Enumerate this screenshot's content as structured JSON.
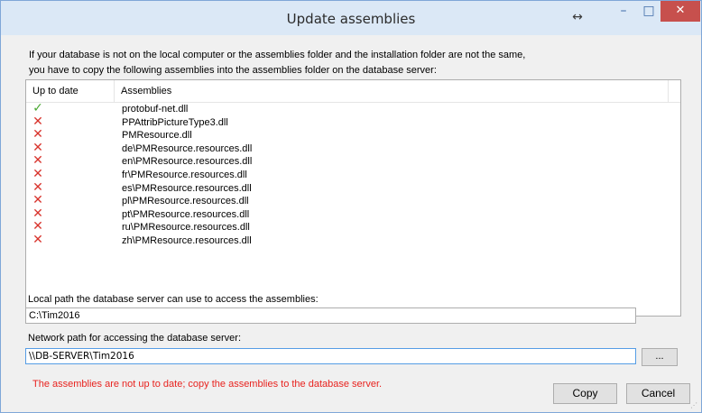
{
  "window": {
    "title": "Update assemblies",
    "resize_glyph": "↔",
    "minimize_glyph": "–",
    "maximize_glyph": "□",
    "close_glyph": "✕"
  },
  "intro": {
    "line1": "If your database is not on the local computer or the assemblies folder and the installation folder are not the same,",
    "line2": "you have to copy the following assemblies into the assemblies folder on the database server:"
  },
  "list": {
    "columns": [
      "Up to date",
      "Assemblies"
    ],
    "rows": [
      {
        "status": "ok",
        "name": "protobuf-net.dll"
      },
      {
        "status": "bad",
        "name": "PPAttribPictureType3.dll"
      },
      {
        "status": "bad",
        "name": "PMResource.dll"
      },
      {
        "status": "bad",
        "name": "de\\PMResource.resources.dll"
      },
      {
        "status": "bad",
        "name": "en\\PMResource.resources.dll"
      },
      {
        "status": "bad",
        "name": "fr\\PMResource.resources.dll"
      },
      {
        "status": "bad",
        "name": "es\\PMResource.resources.dll"
      },
      {
        "status": "bad",
        "name": "pl\\PMResource.resources.dll"
      },
      {
        "status": "bad",
        "name": "pt\\PMResource.resources.dll"
      },
      {
        "status": "bad",
        "name": "ru\\PMResource.resources.dll"
      },
      {
        "status": "bad",
        "name": "zh\\PMResource.resources.dll"
      }
    ],
    "icons": {
      "ok": "✓",
      "bad": "✕"
    },
    "icon_colors": {
      "ok": "#4aa833",
      "bad": "#d8332c"
    }
  },
  "local_path": {
    "label": "Local path the database server can use to access the assemblies:",
    "value": "C:\\Tim2016"
  },
  "network_path": {
    "label": "Network path for accessing the database server:",
    "value": "\\\\DB-SERVER\\Tim2016",
    "browse_label": "..."
  },
  "status_message": "The assemblies are not up to date; copy the assemblies to the database server.",
  "status_color": "#e8231f",
  "buttons": {
    "copy": "Copy",
    "cancel": "Cancel"
  }
}
